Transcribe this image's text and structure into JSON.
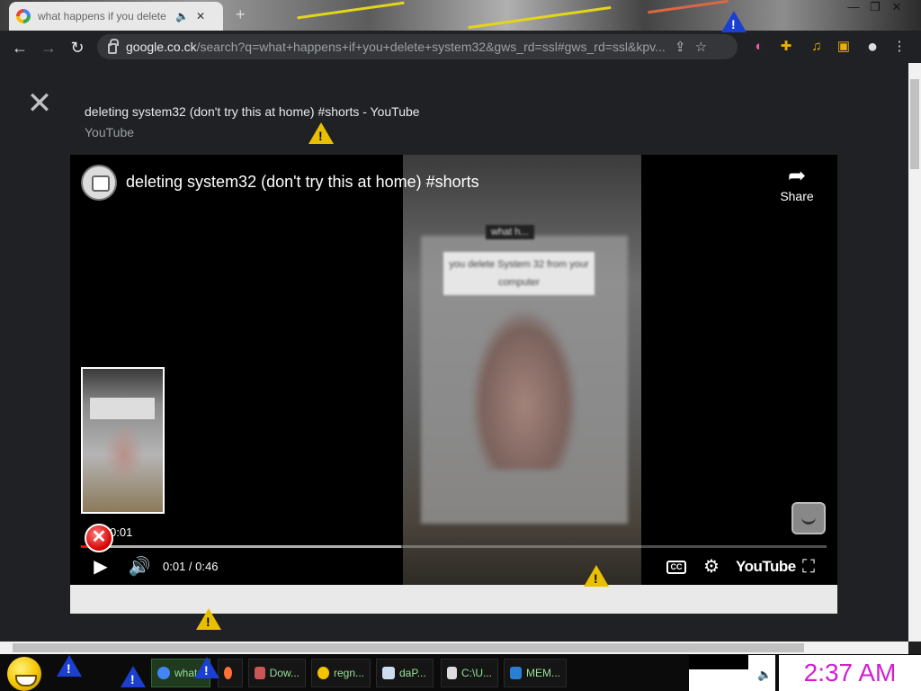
{
  "browser": {
    "tab_title": "what happens if you delete s",
    "tab_audio_icon": "speaker-icon",
    "tab_close": "✕",
    "new_tab": "+",
    "url_host": "google.co.ck",
    "url_path": "/search?q=what+happens+if+you+delete+system32&gws_rd=ssl#gws_rd=ssl&kpv...",
    "window_controls": [
      "—",
      "❐",
      "✕"
    ]
  },
  "result": {
    "title": "deleting system32 (don't try this at home) #shorts - YouTube",
    "source": "YouTube"
  },
  "player": {
    "video_title": "deleting system32 (don't try this at home) #shorts",
    "share_label": "Share",
    "caption_top": "what h...",
    "caption_bottom": "you delete System 32 from your computer",
    "thumbnail_time": "0:01",
    "timecode": "0:01 / 0:46",
    "progress_fraction": 0.02,
    "buffered_fraction": 0.43,
    "cc_label": "CC",
    "logo_text": "YouTube"
  },
  "taskbar": {
    "items": [
      {
        "label": "what",
        "icon": "chrome-icon",
        "color": "#4285f4",
        "active": true
      },
      {
        "label": "",
        "icon": "firefox-icon",
        "color": "#ff7139",
        "active": false
      },
      {
        "label": "Dow...",
        "icon": "download-icon",
        "color": "#c55",
        "active": false
      },
      {
        "label": "regn...",
        "icon": "smiley-icon",
        "color": "#f4c400",
        "active": false
      },
      {
        "label": "daP...",
        "icon": "notepad-icon",
        "color": "#cde",
        "active": false
      },
      {
        "label": "C:\\U...",
        "icon": "filezilla-icon",
        "color": "#ddd",
        "active": false
      },
      {
        "label": "MEM...",
        "icon": "memory-icon",
        "color": "#2a7fd4",
        "active": false
      }
    ],
    "clock": "2:37 AM"
  }
}
